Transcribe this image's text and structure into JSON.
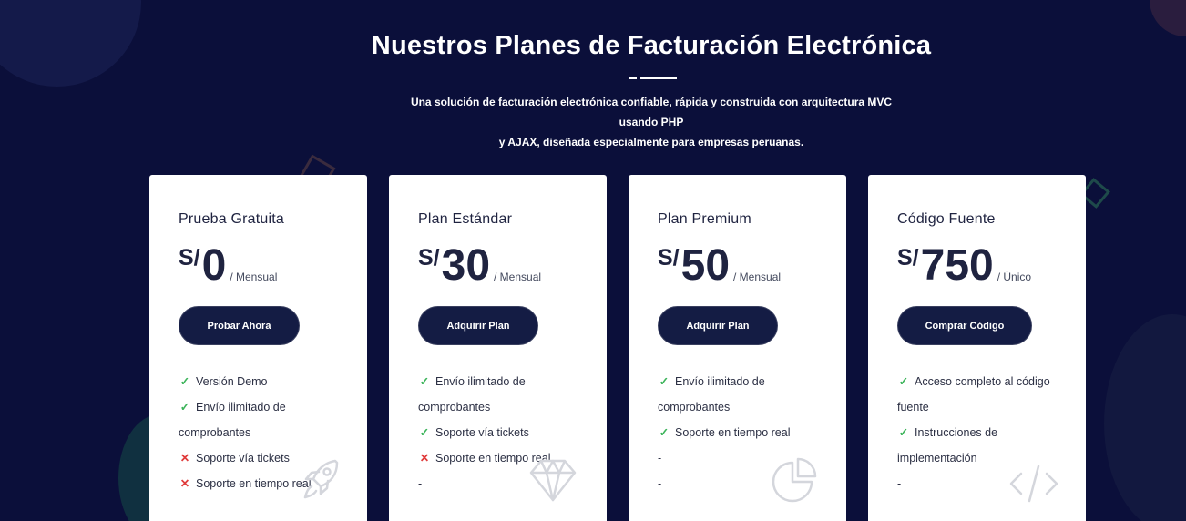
{
  "header": {
    "title": "Nuestros Planes de Facturación Electrónica",
    "subtitle_line1": "Una solución de facturación electrónica confiable, rápida y construida con arquitectura MVC usando PHP",
    "subtitle_line2": "y AJAX, diseñada especialmente para empresas peruanas."
  },
  "colors": {
    "background": "#0b0f3a",
    "button": "#141c44",
    "check": "#3cb45a",
    "cross": "#e03a3a"
  },
  "plans": [
    {
      "name": "Prueba Gratuita",
      "currency": "S/",
      "amount": "0",
      "period": "/ Mensual",
      "button": "Probar Ahora",
      "icon": "rocket-icon",
      "features": [
        {
          "mark": "✓",
          "status": "included",
          "text": "Versión Demo"
        },
        {
          "mark": "✓",
          "status": "included",
          "text": "Envío ilimitado de comprobantes"
        },
        {
          "mark": "✕",
          "status": "excluded",
          "text": "Soporte vía tickets"
        },
        {
          "mark": "✕",
          "status": "excluded",
          "text": "Soporte en tiempo real"
        }
      ]
    },
    {
      "name": "Plan Estándar",
      "currency": "S/",
      "amount": "30",
      "period": "/ Mensual",
      "button": "Adquirir Plan",
      "icon": "diamond-icon",
      "features": [
        {
          "mark": "✓",
          "status": "included",
          "text": "Envío ilimitado de comprobantes"
        },
        {
          "mark": "✓",
          "status": "included",
          "text": "Soporte vía tickets"
        },
        {
          "mark": "✕",
          "status": "excluded",
          "text": "Soporte en tiempo real"
        },
        {
          "mark": "",
          "status": "none",
          "text": "-"
        }
      ]
    },
    {
      "name": "Plan Premium",
      "currency": "S/",
      "amount": "50",
      "period": "/ Mensual",
      "button": "Adquirir Plan",
      "icon": "pie-chart-icon",
      "features": [
        {
          "mark": "✓",
          "status": "included",
          "text": "Envío ilimitado de comprobantes"
        },
        {
          "mark": "✓",
          "status": "included",
          "text": "Soporte en tiempo real"
        },
        {
          "mark": "",
          "status": "none",
          "text": "-"
        },
        {
          "mark": "",
          "status": "none",
          "text": "-"
        }
      ]
    },
    {
      "name": "Código Fuente",
      "currency": "S/",
      "amount": "750",
      "period": "/ Único",
      "button": "Comprar Código",
      "icon": "code-icon",
      "features": [
        {
          "mark": "✓",
          "status": "included",
          "text": "Acceso completo al código fuente"
        },
        {
          "mark": "✓",
          "status": "included",
          "text": "Instrucciones de implementación"
        },
        {
          "mark": "",
          "status": "none",
          "text": "-"
        }
      ]
    }
  ]
}
